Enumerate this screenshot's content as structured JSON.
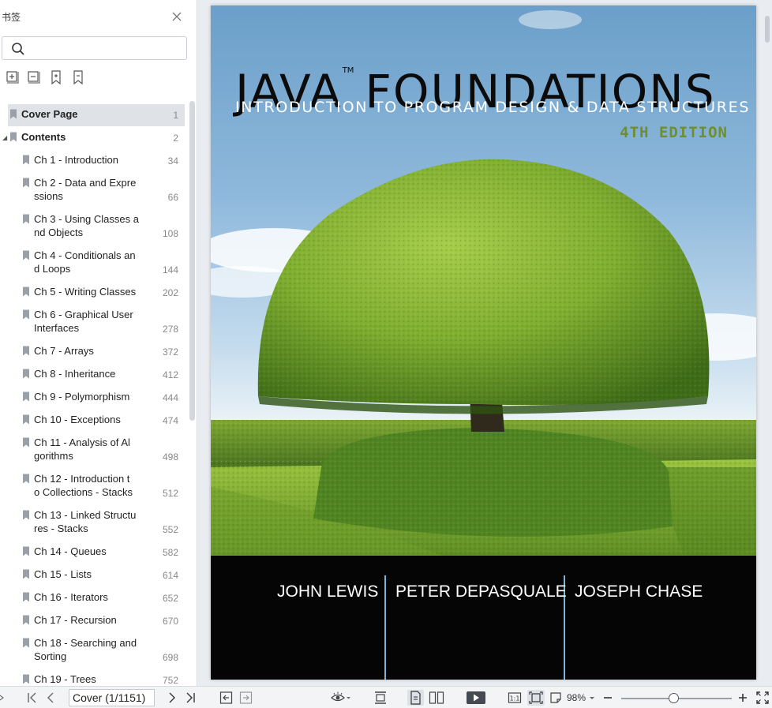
{
  "sidebar": {
    "title": "书签",
    "search": {
      "value": "",
      "placeholder": ""
    },
    "bookmarks": [
      {
        "label": "Cover Page",
        "page": "1",
        "level": 0,
        "selected": true,
        "bold": true
      },
      {
        "label": "Contents",
        "page": "2",
        "level": 0,
        "expanded": true,
        "bold": true
      },
      {
        "label": "Ch 1 - Introduction",
        "page": "34",
        "level": 1
      },
      {
        "label": "Ch 2 - Data and Expre\nssions",
        "page": "66",
        "level": 1
      },
      {
        "label": "Ch 3 - Using Classes a\nnd Objects",
        "page": "108",
        "level": 1
      },
      {
        "label": "Ch 4 - Conditionals an\nd Loops",
        "page": "144",
        "level": 1
      },
      {
        "label": "Ch 5 - Writing Classes",
        "page": "202",
        "level": 1
      },
      {
        "label": "Ch 6 - Graphical User\nInterfaces",
        "page": "278",
        "level": 1
      },
      {
        "label": "Ch 7 - Arrays",
        "page": "372",
        "level": 1
      },
      {
        "label": "Ch 8 - Inheritance",
        "page": "412",
        "level": 1
      },
      {
        "label": "Ch 9 - Polymorphism",
        "page": "444",
        "level": 1
      },
      {
        "label": "Ch 10 - Exceptions",
        "page": "474",
        "level": 1
      },
      {
        "label": "Ch 11 - Analysis of Al\ngorithms",
        "page": "498",
        "level": 1
      },
      {
        "label": "Ch 12 - Introduction t\no Collections - Stacks",
        "page": "512",
        "level": 1
      },
      {
        "label": "Ch 13 - Linked Structu\nres - Stacks",
        "page": "552",
        "level": 1
      },
      {
        "label": "Ch 14 - Queues",
        "page": "582",
        "level": 1
      },
      {
        "label": "Ch 15 - Lists",
        "page": "614",
        "level": 1
      },
      {
        "label": "Ch 16 - Iterators",
        "page": "652",
        "level": 1
      },
      {
        "label": "Ch 17 - Recursion",
        "page": "670",
        "level": 1
      },
      {
        "label": "Ch 18 - Searching and\nSorting",
        "page": "698",
        "level": 1
      },
      {
        "label": "Ch 19 - Trees",
        "page": "752",
        "level": 1
      }
    ]
  },
  "cover": {
    "title": "JAVA",
    "tm": "TM",
    "title2": "FOUNDATIONS",
    "subtitle": "INTRODUCTION TO PROGRAM DESIGN & DATA STRUCTURES",
    "edition": "4TH EDITION",
    "authors": [
      "JOHN LEWIS",
      "PETER DEPASQUALE",
      "JOSEPH CHASE"
    ]
  },
  "toolbar": {
    "page_field": "Cover (1/1151)",
    "zoom": "98%"
  },
  "colors": {
    "edition": "#6f8f2c",
    "band": "#050505",
    "divider": "#7fb3d8"
  }
}
